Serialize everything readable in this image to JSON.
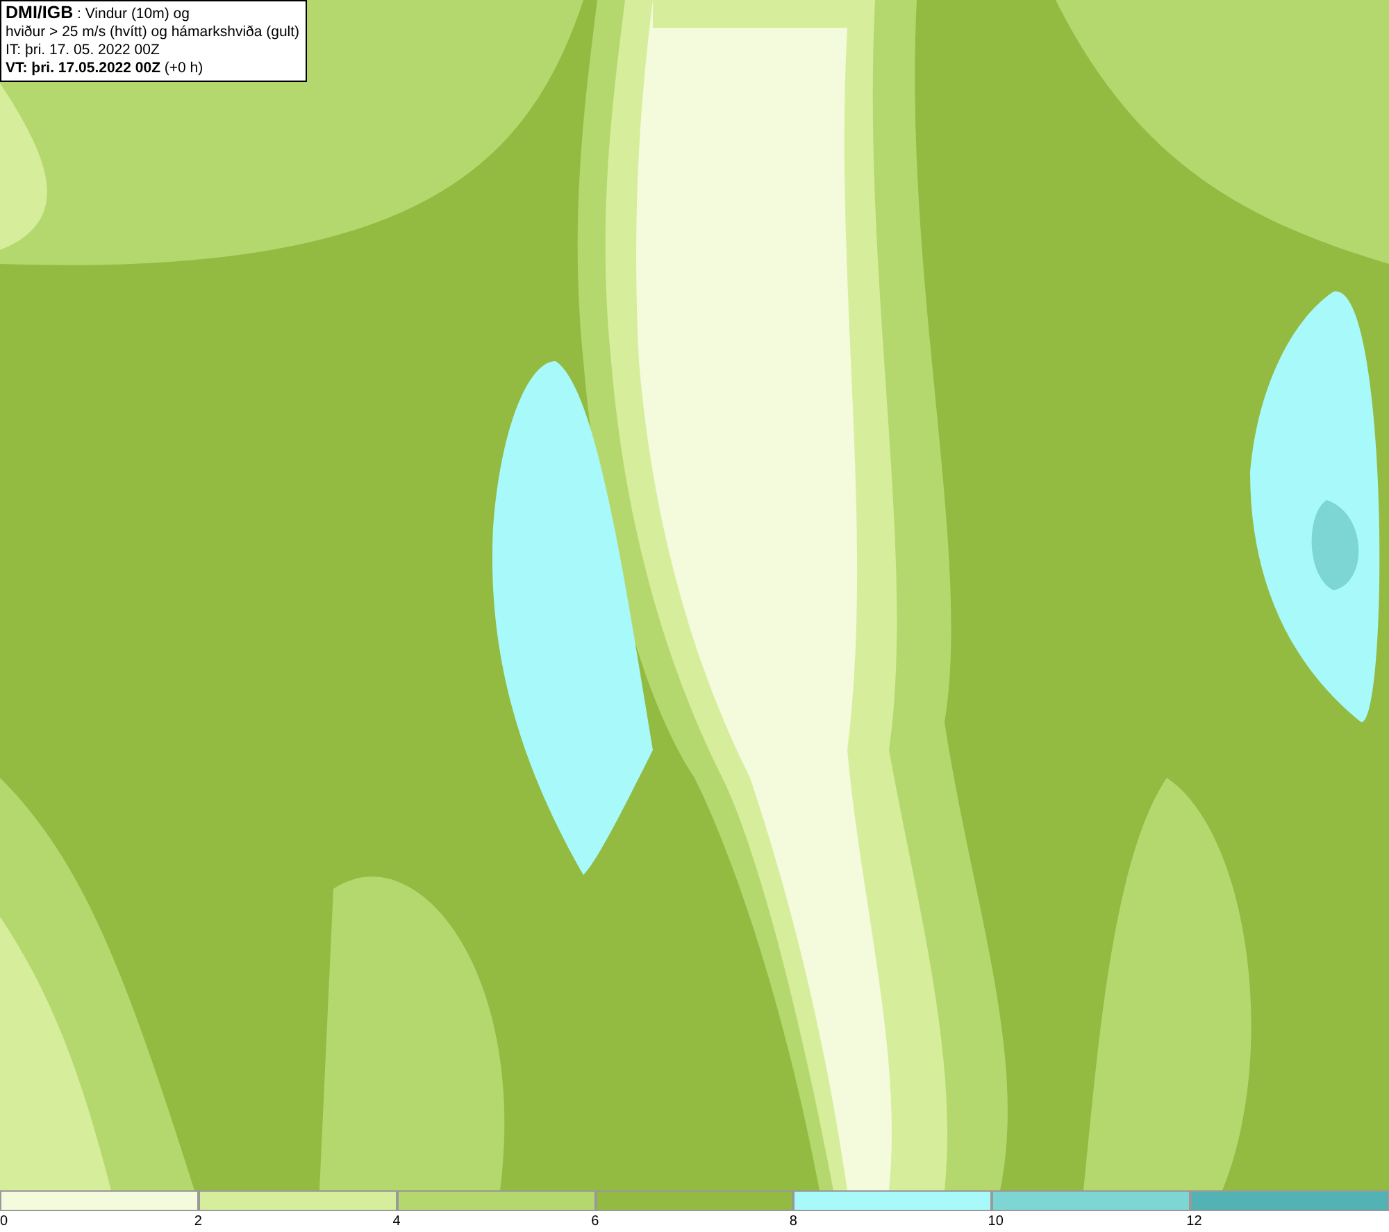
{
  "info_box": {
    "lines": [
      "**DMI/IGB** : Vindur (10m) og",
      "hviður > 25 m/s (hvítt) og hámarkshviða (gult)",
      "IT: þri. 17. 05. 2022 00Z",
      "**VT: þri. 17.05.2022 00Z** (+0 h)"
    ]
  },
  "legend": [
    {
      "label": "0",
      "color": "#f4fadc"
    },
    {
      "label": "2",
      "color": "#d6ee9c"
    },
    {
      "label": "4",
      "color": "#b5d86e"
    },
    {
      "label": "6",
      "color": "#93bb42"
    },
    {
      "label": "8",
      "color": "#a8fafa"
    },
    {
      "label": "10",
      "color": "#7ed6d4"
    },
    {
      "label": "12",
      "color": "#52b2b4"
    }
  ]
}
